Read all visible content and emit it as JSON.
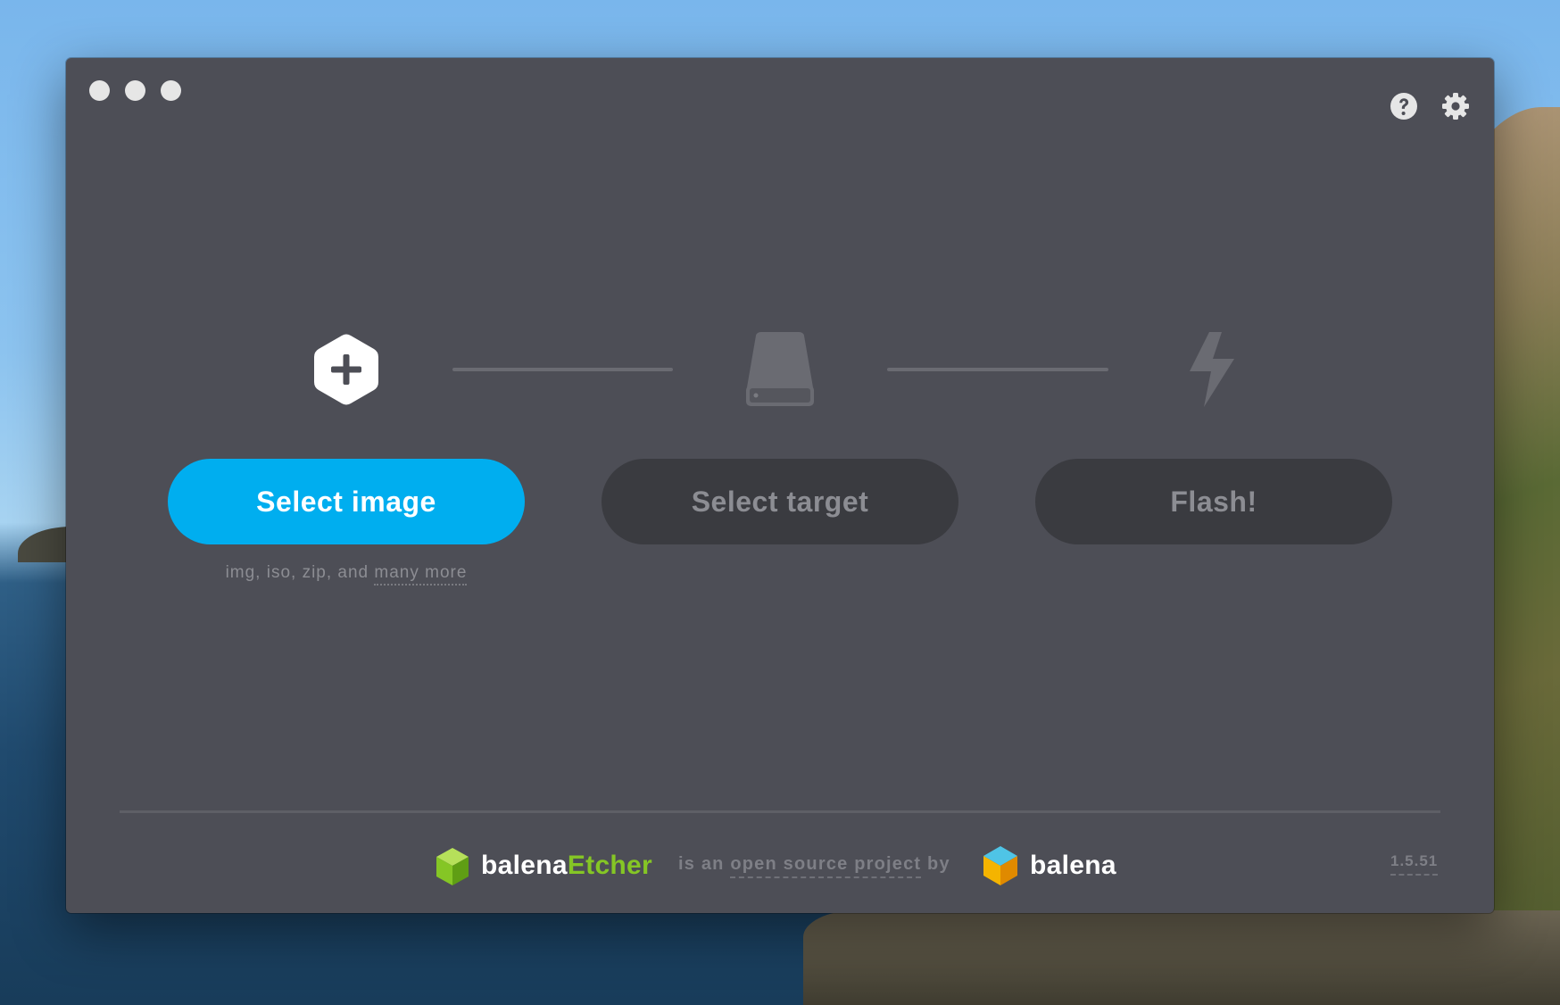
{
  "desktop": {
    "background": "macOS Catalina coastline"
  },
  "window": {
    "background_color": "#4d4e56",
    "traffic_lights": [
      "close",
      "minimize",
      "zoom"
    ]
  },
  "toolbar": {
    "help_icon": "question-circle-icon",
    "settings_icon": "gear-icon"
  },
  "steps": {
    "image": {
      "icon": "hex-plus-icon",
      "button_label": "Select image",
      "button_color": "#00aeef"
    },
    "target": {
      "icon": "drive-icon",
      "button_label": "Select target"
    },
    "flash": {
      "icon": "lightning-bolt-icon",
      "button_label": "Flash!"
    }
  },
  "image_hint": {
    "prefix": "img, iso, zip, and ",
    "link": "many more"
  },
  "footer": {
    "brand_part1": "balena",
    "brand_part2": "Etcher",
    "brand_accent": "#85c625",
    "byline_prefix": "is an ",
    "byline_link": "open source project",
    "byline_suffix": " by",
    "company": "balena",
    "version": "1.5.51"
  }
}
